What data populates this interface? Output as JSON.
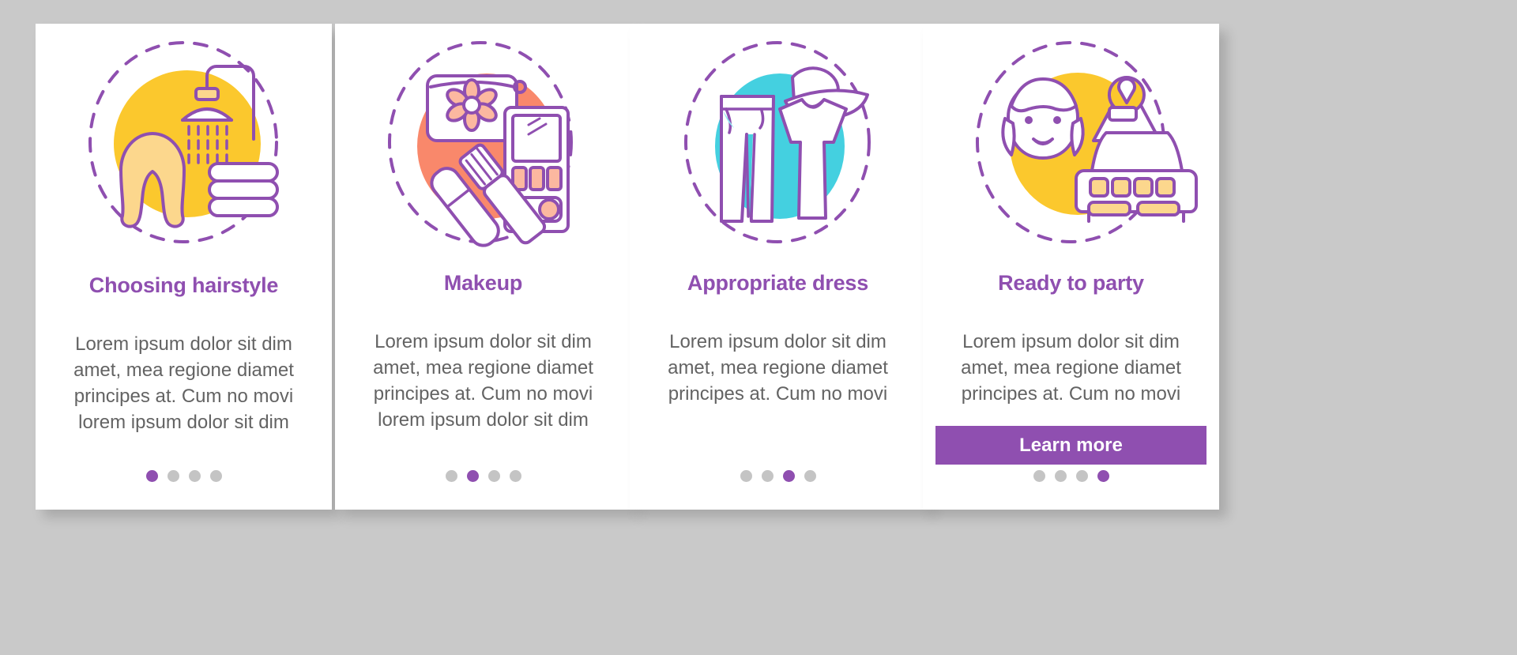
{
  "page": {
    "background_color": "#c9c9c9",
    "accent_color": "#8f4fb0",
    "body_text_color": "#636363",
    "dot_inactive_color": "#c4c4c4"
  },
  "screens": [
    {
      "id": "choosing-hairstyle",
      "title": "Choosing hairstyle",
      "body": "Lorem ipsum dolor sit dim amet, mea regione diamet principes at. Cum no movi lorem ipsum dolor sit dim",
      "illustration": "hair-shower-towels-icon",
      "blob_color": "#fbc82d",
      "accent_fill": "#fcd78d",
      "has_cta": false,
      "cta_label": "",
      "dots": [
        true,
        false,
        false,
        false
      ]
    },
    {
      "id": "makeup",
      "title": "Makeup",
      "body": "Lorem ipsum dolor sit dim amet, mea regione diamet principes at. Cum no movi lorem ipsum dolor sit dim",
      "illustration": "cosmetic-bag-palette-icon",
      "blob_color": "#f9886b",
      "accent_fill": "#fcb8a0",
      "has_cta": false,
      "cta_label": "",
      "dots": [
        false,
        true,
        false,
        false
      ]
    },
    {
      "id": "appropriate-dress",
      "title": "Appropriate dress",
      "body": "Lorem ipsum dolor sit dim amet, mea regione diamet principes at. Cum no movi",
      "illustration": "pants-dress-hat-icon",
      "blob_color": "#44d0e0",
      "accent_fill": "#8fe6f2",
      "has_cta": false,
      "cta_label": "",
      "dots": [
        false,
        false,
        true,
        false
      ]
    },
    {
      "id": "ready-to-party",
      "title": "Ready to party",
      "body": "Lorem ipsum dolor sit dim amet, mea regione diamet principes at. Cum no movi",
      "illustration": "woman-taxi-location-icon",
      "blob_color": "#fbc82d",
      "accent_fill": "#fcd78d",
      "has_cta": true,
      "cta_label": "Learn more",
      "dots": [
        false,
        false,
        false,
        true
      ]
    }
  ]
}
